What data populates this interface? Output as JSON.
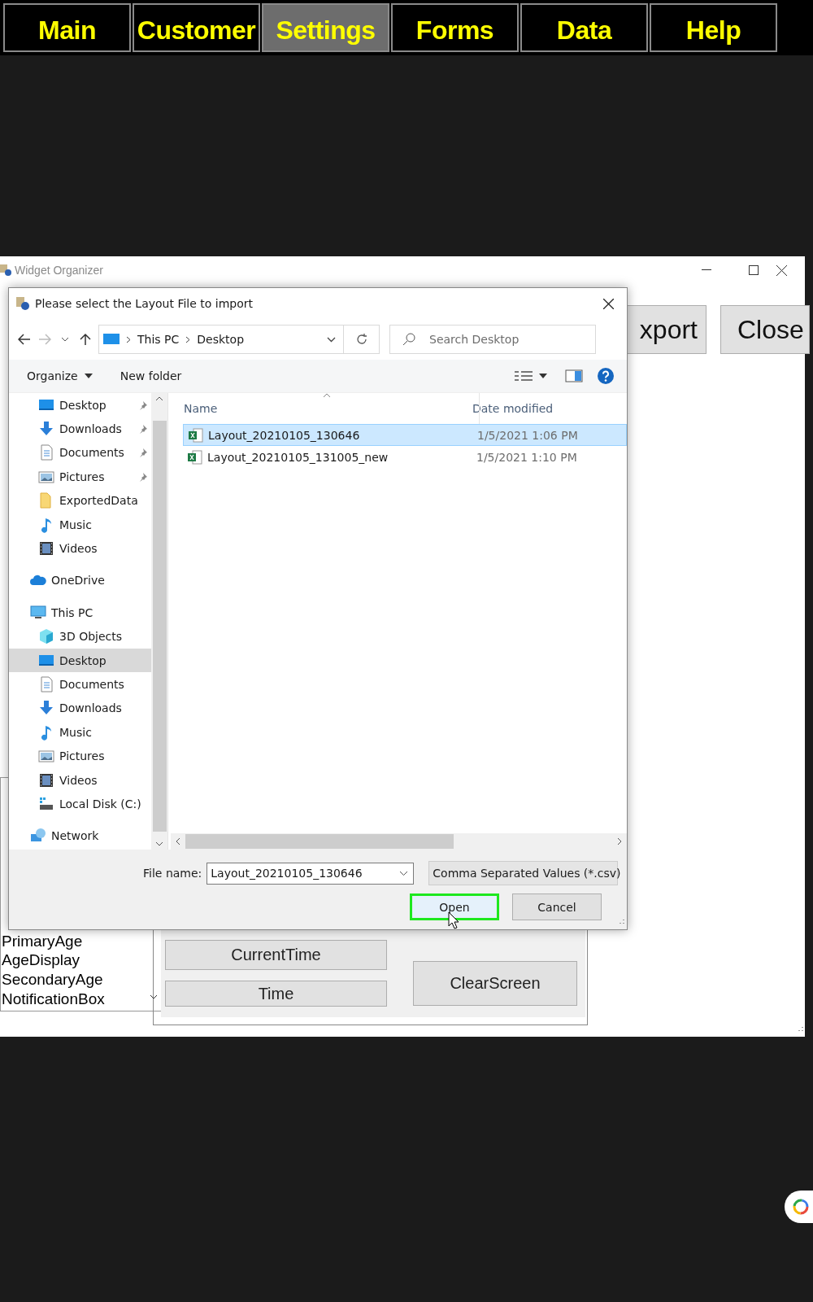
{
  "menu_tabs": [
    {
      "label": "Main",
      "selected": false
    },
    {
      "label": "Customer",
      "selected": false
    },
    {
      "label": "Settings",
      "selected": true
    },
    {
      "label": "Forms",
      "selected": false
    },
    {
      "label": "Data",
      "selected": false
    },
    {
      "label": "Help",
      "selected": false
    }
  ],
  "main_window": {
    "title": "Widget Organizer",
    "buttons": [
      "xport",
      "Close"
    ],
    "list": [
      {
        "label": "PrimaryAge",
        "selected": false
      },
      {
        "label": "AgeDisplay",
        "selected": false
      },
      {
        "label": "SecondaryAge",
        "selected": false
      },
      {
        "label": "NotificationBox",
        "selected": false
      }
    ],
    "panel_buttons": [
      "CurrentTime",
      "Time",
      "ClearScreen"
    ]
  },
  "dialog": {
    "title": "Please select the Layout File to import",
    "path": [
      "This PC",
      "Desktop"
    ],
    "search": {
      "placeholder": "Search Desktop"
    },
    "toolbar": [
      "Organize",
      "New folder"
    ],
    "quick_access": [
      {
        "label": "Desktop",
        "kind": "desktop",
        "pinned": true
      },
      {
        "label": "Downloads",
        "kind": "downloads",
        "pinned": true
      },
      {
        "label": "Documents",
        "kind": "documents",
        "pinned": true
      },
      {
        "label": "Pictures",
        "kind": "pictures",
        "pinned": true
      },
      {
        "label": "ExportedData",
        "kind": "folder",
        "pinned": false
      },
      {
        "label": "Music",
        "kind": "music",
        "pinned": false
      },
      {
        "label": "Videos",
        "kind": "videos",
        "pinned": false
      }
    ],
    "nav": [
      {
        "label": "OneDrive",
        "kind": "cloud",
        "selected": false
      },
      {
        "label": "This PC",
        "kind": "pc",
        "selected": false,
        "children": [
          {
            "label": "3D Objects",
            "kind": "cube",
            "selected": false
          },
          {
            "label": "Desktop",
            "kind": "desktop",
            "selected": true
          },
          {
            "label": "Documents",
            "kind": "documents",
            "selected": false
          },
          {
            "label": "Downloads",
            "kind": "downloads",
            "selected": false
          },
          {
            "label": "Music",
            "kind": "music",
            "selected": false
          },
          {
            "label": "Pictures",
            "kind": "pictures",
            "selected": false
          },
          {
            "label": "Videos",
            "kind": "videos",
            "selected": false
          },
          {
            "label": "Local Disk (C:)",
            "kind": "disk",
            "selected": false
          }
        ]
      },
      {
        "label": "Network",
        "kind": "network",
        "selected": false
      }
    ],
    "columns": [
      "Name",
      "Date modified"
    ],
    "files": [
      {
        "name": "Layout_20210105_130646",
        "date": "1/5/2021 1:06 PM",
        "selected": true
      },
      {
        "name": "Layout_20210105_131005_new",
        "date": "1/5/2021 1:10 PM",
        "selected": false
      }
    ],
    "file_name_label": "File name:",
    "file_name": "Layout_20210105_130646",
    "file_type": "Comma Separated Values (*.csv)",
    "buttons": [
      {
        "label": "Open",
        "highlighted": true
      },
      {
        "label": "Cancel",
        "highlighted": false
      }
    ]
  }
}
